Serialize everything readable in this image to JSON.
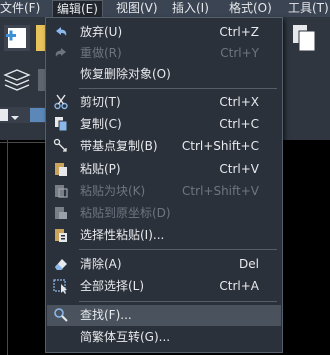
{
  "menubar": {
    "items": [
      {
        "label": "文件(F)"
      },
      {
        "label": "编辑(E)"
      },
      {
        "label": "视图(V)"
      },
      {
        "label": "插入(I)"
      },
      {
        "label": "格式(O)"
      },
      {
        "label": "工具(T)"
      }
    ],
    "active_index": 1
  },
  "edit_menu": {
    "items": [
      {
        "label": "放弃(U)",
        "shortcut": "Ctrl+Z",
        "icon": "undo-icon",
        "enabled": true
      },
      {
        "label": "重做(R)",
        "shortcut": "Ctrl+Y",
        "icon": "redo-icon",
        "enabled": false
      },
      {
        "label": "恢复删除对象(O)",
        "shortcut": "",
        "icon": "",
        "enabled": true
      },
      {
        "label": "剪切(T)",
        "shortcut": "Ctrl+X",
        "icon": "scissors-icon",
        "enabled": true
      },
      {
        "label": "复制(C)",
        "shortcut": "Ctrl+C",
        "icon": "copy-icon",
        "enabled": true
      },
      {
        "label": "带基点复制(B)",
        "shortcut": "Ctrl+Shift+C",
        "icon": "copy-basepoint-icon",
        "enabled": true
      },
      {
        "label": "粘贴(P)",
        "shortcut": "Ctrl+V",
        "icon": "paste-icon",
        "enabled": true
      },
      {
        "label": "粘贴为块(K)",
        "shortcut": "Ctrl+Shift+V",
        "icon": "paste-block-icon",
        "enabled": false
      },
      {
        "label": "粘贴到原坐标(D)",
        "shortcut": "",
        "icon": "paste-original-coords-icon",
        "enabled": false
      },
      {
        "label": "选择性粘贴(I)...",
        "shortcut": "",
        "icon": "paste-special-icon",
        "enabled": true
      },
      {
        "label": "清除(A)",
        "shortcut": "Del",
        "icon": "eraser-icon",
        "enabled": true
      },
      {
        "label": "全部选择(L)",
        "shortcut": "Ctrl+A",
        "icon": "select-all-icon",
        "enabled": true
      },
      {
        "label": "查找(F)...",
        "shortcut": "",
        "icon": "find-icon",
        "enabled": true,
        "highlighted": true
      },
      {
        "label": "简繁体互转(G)...",
        "shortcut": "",
        "icon": "",
        "enabled": true
      }
    ]
  },
  "colors": {
    "menu_bg": "#2b313a",
    "menubar_bg": "#3b4452",
    "highlight_bg": "#4a525d",
    "text": "#e8eaed",
    "disabled_text": "#6e7580",
    "accent_blue": "#3d8fd6"
  }
}
